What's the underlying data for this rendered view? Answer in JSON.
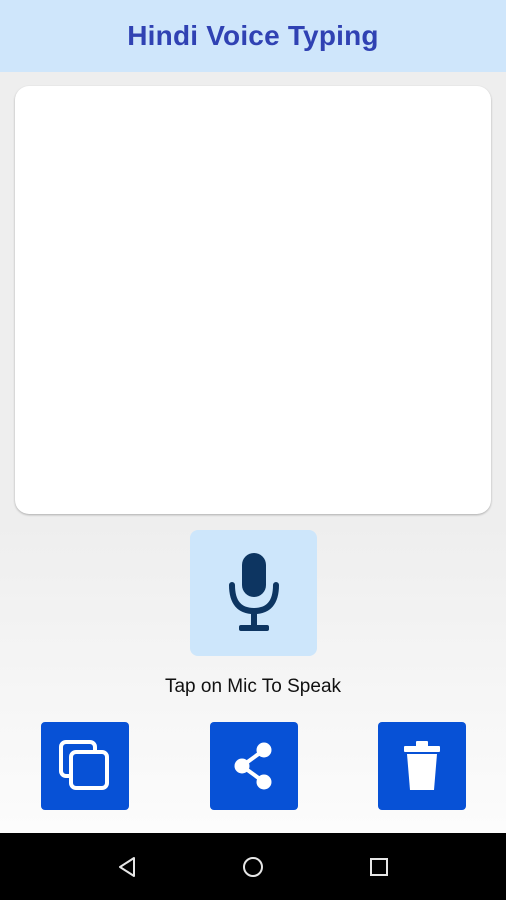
{
  "app": {
    "title": "Hindi Voice Typing"
  },
  "editor": {
    "text": ""
  },
  "mic": {
    "icon": "microphone-icon",
    "hint": "Tap on Mic To Speak"
  },
  "actions": [
    {
      "name": "copy",
      "icon": "copy-icon"
    },
    {
      "name": "share",
      "icon": "share-icon"
    },
    {
      "name": "delete",
      "icon": "trash-icon"
    }
  ],
  "navbar": {
    "buttons": [
      "back-icon",
      "home-icon",
      "recents-icon"
    ]
  },
  "colors": {
    "appbar_bg": "#cfe6fb",
    "title": "#3042b3",
    "mic_bg": "#cde6fb",
    "mic_icon": "#0d3561",
    "action_bg": "#0751d6"
  }
}
